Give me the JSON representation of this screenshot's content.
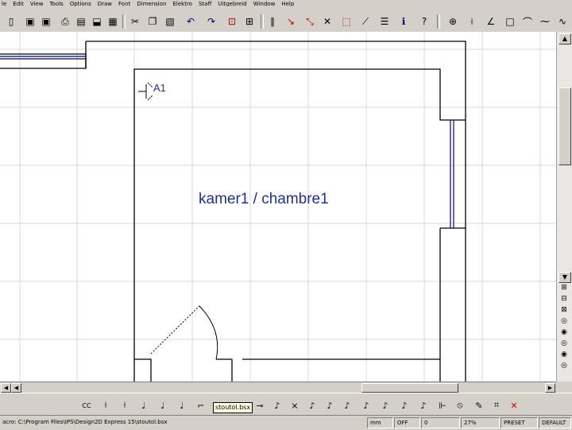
{
  "menu": [
    "le",
    "Edit",
    "View",
    "Tools",
    "Options",
    "Draw",
    "Font",
    "Dimension",
    "Elektro",
    "Staff",
    "Uitgebreid",
    "Window",
    "Help"
  ],
  "drawing": {
    "room_label": "kamer1 / chambre1",
    "socket_label": "A1"
  },
  "bottom_toolbar": {
    "first_button": "CC",
    "tooltip": "stoutol.bsx"
  },
  "status": {
    "macro_path": "acro: C:\\Program Files\\IPS\\Design2D Express 15\\stoutol.bsx",
    "unit": "mm",
    "snap": "OFF",
    "layer": "0",
    "zoom": "27%",
    "preset": "PRESET",
    "style": "DEFAULT"
  },
  "colors": {
    "drawing_text": "#1f2f9f",
    "walls": "#000000",
    "window_frame": "#000080",
    "grid": "#d8d8d8"
  }
}
